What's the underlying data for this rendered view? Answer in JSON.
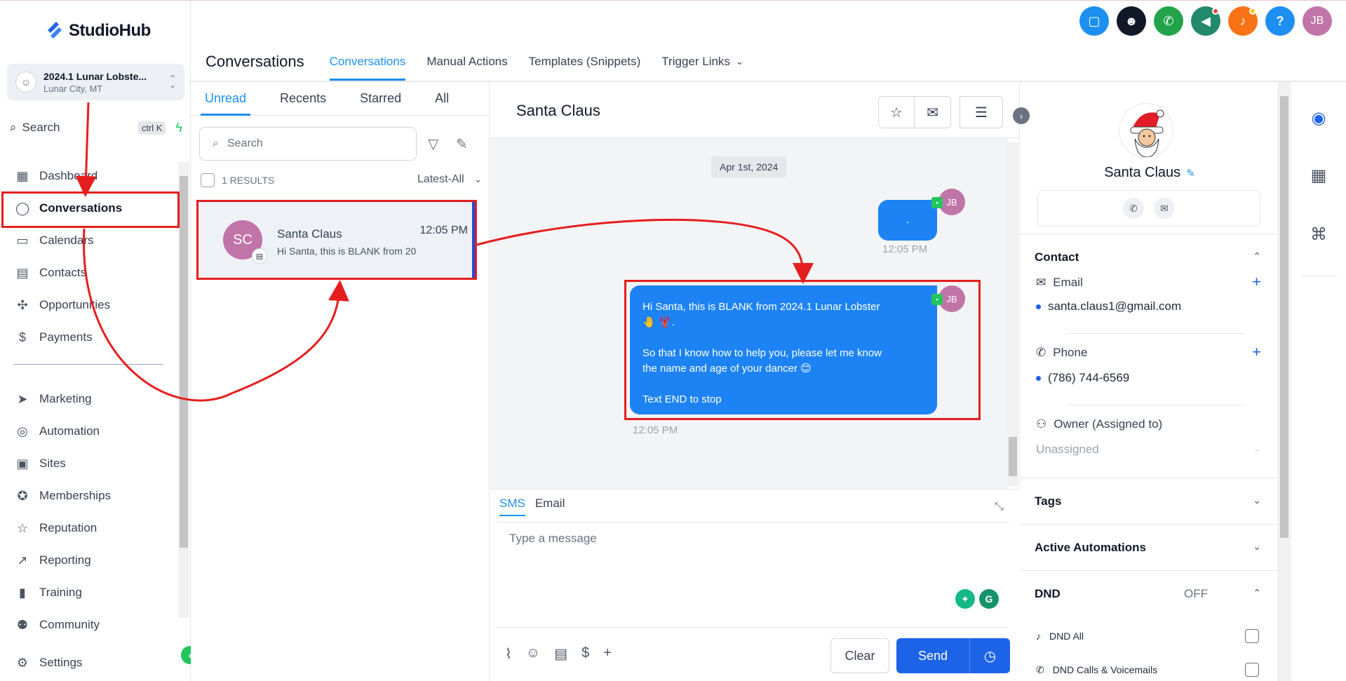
{
  "app": {
    "logo_text": "StudioHub"
  },
  "location": {
    "name": "2024.1 Lunar Lobste...",
    "city": "Lunar City, MT"
  },
  "search": {
    "label": "Search",
    "shortcut": "ctrl K"
  },
  "sidebar": {
    "items": [
      {
        "label": "Dashboard",
        "icon": "dashboard-icon"
      },
      {
        "label": "Conversations",
        "icon": "chat-icon"
      },
      {
        "label": "Calendars",
        "icon": "calendar-icon"
      },
      {
        "label": "Contacts",
        "icon": "contacts-icon"
      },
      {
        "label": "Opportunities",
        "icon": "opportunities-icon"
      },
      {
        "label": "Payments",
        "icon": "payments-icon"
      },
      {
        "label": "Marketing",
        "icon": "send-icon"
      },
      {
        "label": "Automation",
        "icon": "automation-icon"
      },
      {
        "label": "Sites",
        "icon": "sites-icon"
      },
      {
        "label": "Memberships",
        "icon": "badge-icon"
      },
      {
        "label": "Reputation",
        "icon": "star-icon"
      },
      {
        "label": "Reporting",
        "icon": "trend-icon"
      },
      {
        "label": "Training",
        "icon": "book-icon"
      },
      {
        "label": "Community",
        "icon": "people-icon"
      }
    ],
    "settings_label": "Settings"
  },
  "header": {
    "title": "Conversations",
    "tabs": [
      "Conversations",
      "Manual Actions",
      "Templates (Snippets)",
      "Trigger Links"
    ],
    "user_initials": "JB",
    "accent": "#1d8ff0"
  },
  "list": {
    "tabs": [
      "Unread",
      "Recents",
      "Starred",
      "All"
    ],
    "search_placeholder": "Search",
    "results": "1 RESULTS",
    "sort": "Latest-All",
    "item": {
      "initials": "SC",
      "name": "Santa Claus",
      "time": "12:05 PM",
      "preview": "Hi Santa, this is BLANK from 20"
    }
  },
  "chat": {
    "title": "Santa Claus",
    "date": "Apr 1st, 2024",
    "msg1": {
      "text": ".",
      "time": "12:05 PM",
      "sender": "JB"
    },
    "msg2": {
      "line1": "Hi Santa, this is BLANK from 2024.1 Lunar Lobster",
      "line2": "🤚 🦞.",
      "line3": "So that I know how to help you, please let me know",
      "line4": "the name and age of your dancer 😊",
      "line5": "Text END to stop",
      "time": "12:05 PM",
      "sender": "JB"
    },
    "composer": {
      "tabs": [
        "SMS",
        "Email"
      ],
      "placeholder": "Type a message",
      "clear": "Clear",
      "send": "Send"
    }
  },
  "contact": {
    "name": "Santa Claus",
    "section_contact": "Contact",
    "email_label": "Email",
    "email": "santa.claus1@gmail.com",
    "phone_label": "Phone",
    "phone": "(786) 744-6569",
    "owner_label": "Owner (Assigned to)",
    "owner": "Unassigned",
    "tags": "Tags",
    "automations": "Active Automations",
    "dnd": "DND",
    "dnd_status": "OFF",
    "dnd_all": "DND All",
    "dnd_calls": "DND Calls & Voicemails"
  },
  "colors": {
    "annotation": "#e41e1e",
    "bubble": "#1d83f5",
    "avatar": "#c174a8",
    "send": "#1d63e8"
  }
}
